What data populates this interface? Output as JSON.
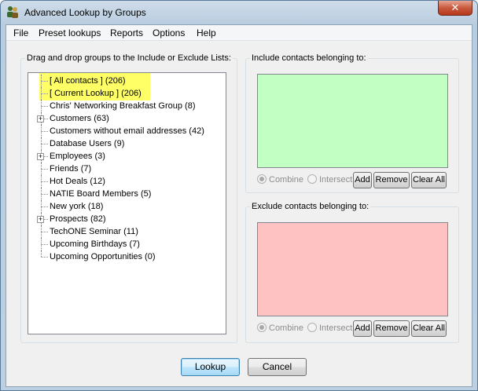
{
  "window": {
    "title": "Advanced Lookup by Groups",
    "close_label": "✕"
  },
  "menu": [
    "File",
    "Preset lookups",
    "Reports",
    "Options",
    "Help"
  ],
  "groups_panel": {
    "label": "Drag and drop groups to the Include or Exclude Lists:",
    "items": [
      {
        "label": "[ All contacts ] (206)",
        "expandable": false
      },
      {
        "label": "[ Current Lookup ] (206)",
        "expandable": false
      },
      {
        "label": "Chris' Networking Breakfast Group (8)",
        "expandable": false
      },
      {
        "label": "Customers (63)",
        "expandable": true
      },
      {
        "label": "Customers without email addresses (42)",
        "expandable": false
      },
      {
        "label": "Database Users (9)",
        "expandable": false
      },
      {
        "label": "Employees (3)",
        "expandable": true
      },
      {
        "label": "Friends (7)",
        "expandable": false
      },
      {
        "label": "Hot Deals (12)",
        "expandable": false
      },
      {
        "label": "NATIE Board Members (5)",
        "expandable": false
      },
      {
        "label": "New york (18)",
        "expandable": false
      },
      {
        "label": "Prospects (82)",
        "expandable": true
      },
      {
        "label": "TechONE Seminar (11)",
        "expandable": false
      },
      {
        "label": "Upcoming Birthdays (7)",
        "expandable": false
      },
      {
        "label": "Upcoming Opportunities (0)",
        "expandable": false
      }
    ]
  },
  "include": {
    "label": "Include contacts belonging to:",
    "combine": "Combine",
    "intersect": "Intersect",
    "add": "Add",
    "remove": "Remove",
    "clear_all": "Clear All"
  },
  "exclude": {
    "label": "Exclude contacts belonging to:",
    "combine": "Combine",
    "intersect": "Intersect",
    "add": "Add",
    "remove": "Remove",
    "clear_all": "Clear All"
  },
  "footer": {
    "lookup": "Lookup",
    "cancel": "Cancel"
  },
  "colors": {
    "include_bg": "#c2ffc2",
    "exclude_bg": "#ffc2c2",
    "highlight": "#ffff66"
  }
}
